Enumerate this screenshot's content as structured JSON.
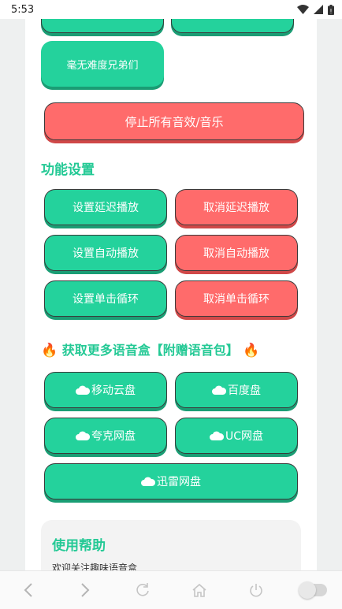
{
  "status_bar": {
    "time": "5:53"
  },
  "buttons_top": {
    "partial_left": "",
    "partial_right": "",
    "easy_mode": "毫无难度兄弟们",
    "stop_all": "停止所有音效/音乐"
  },
  "settings": {
    "title": "功能设置",
    "set_delay": "设置延迟播放",
    "cancel_delay": "取消延迟播放",
    "set_auto": "设置自动播放",
    "cancel_auto": "取消自动播放",
    "set_loop": "设置单击循环",
    "cancel_loop": "取消单击循环"
  },
  "download": {
    "title": "获取更多语音盒【附赠语音包】",
    "fire_icon": "fire-icon",
    "cloud_icon": "cloud-icon",
    "mobile_cloud": "移动云盘",
    "baidu": "百度盘",
    "quark": "夸克网盘",
    "uc": "UC网盘",
    "xunlei": "迅雷网盘"
  },
  "help": {
    "title": "使用帮助",
    "text": "欢迎关注趣味语音盒"
  },
  "colors": {
    "green": "#24d29c",
    "red": "#ff6b6b",
    "title_green": "#24c995"
  }
}
